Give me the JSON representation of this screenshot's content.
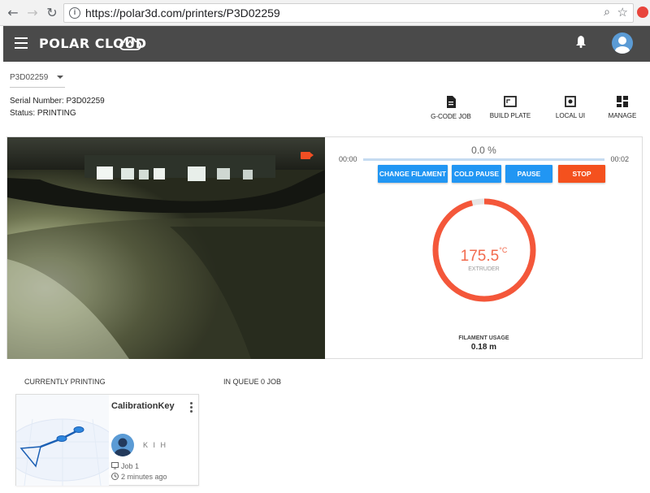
{
  "browser": {
    "url": "https://polar3d.com/printers/P3D02259"
  },
  "app": {
    "logo_text": "POLAR CLOUD"
  },
  "printer": {
    "selected": "P3D02259",
    "serial_line": "Serial Number: P3D02259",
    "status_line": "Status: PRINTING"
  },
  "tools": [
    {
      "label": "G-CODE JOB",
      "icon": "file-icon"
    },
    {
      "label": "BUILD PLATE",
      "icon": "build-plate-icon"
    },
    {
      "label": "LOCAL UI",
      "icon": "local-ui-icon"
    },
    {
      "label": "MANAGE",
      "icon": "grid-icon"
    }
  ],
  "progress": {
    "elapsed": "00:00",
    "remaining": "00:02",
    "percent_text": "0.0 %",
    "fraction": 0.0
  },
  "controls": {
    "change_filament": "CHANGE FILAMENT",
    "cold_pause": "COLD PAUSE",
    "pause": "PAUSE",
    "stop": "STOP"
  },
  "temperature": {
    "value": "175.5",
    "unit": "°C",
    "label": "EXTRUDER",
    "fraction": 0.96
  },
  "filament": {
    "label": "FILAMENT USAGE",
    "value": "0.18 m"
  },
  "sections": {
    "current": "CURRENTLY PRINTING",
    "queue": "IN QUEUE 0 JOB"
  },
  "job": {
    "name": "CalibrationKey",
    "owner": "K I H",
    "job_label": "Job 1",
    "time_label": "2 minutes ago"
  },
  "colors": {
    "appbar": "#4a4a4a",
    "accent_blue": "#2196f3",
    "accent_orange": "#f4511e",
    "gauge": "#f4573a"
  }
}
